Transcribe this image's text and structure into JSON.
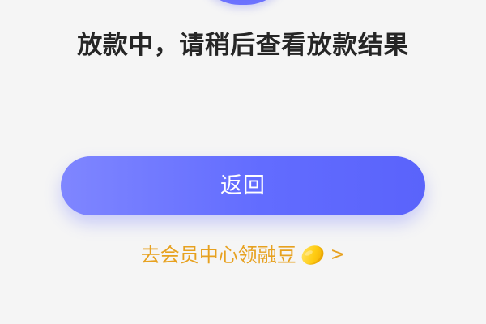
{
  "status": {
    "title": "放款中，请稍后查看放款结果"
  },
  "actions": {
    "back_label": "返回",
    "member_center_label": "去会员中心领融豆",
    "member_center_arrow": ">"
  },
  "colors": {
    "background": "#f5f5f5",
    "primary_button": "#636bff",
    "link": "#e7a11f",
    "title_text": "#262626"
  },
  "icons": {
    "status": "status-graphic-icon",
    "bean": "bean-icon",
    "arrow": "chevron-right-icon"
  }
}
